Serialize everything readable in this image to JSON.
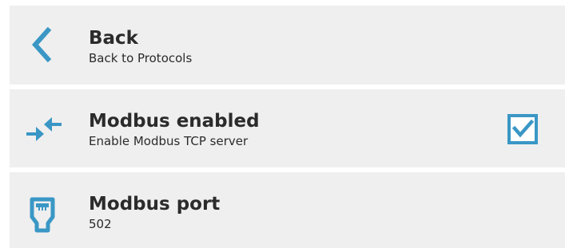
{
  "items": [
    {
      "title": "Back",
      "subtitle": "Back to Protocols",
      "icon": "chevron-left-icon"
    },
    {
      "title": "Modbus enabled",
      "subtitle": "Enable Modbus TCP server",
      "icon": "arrows-converge-icon",
      "checked": true
    },
    {
      "title": "Modbus port",
      "subtitle": "502",
      "icon": "ethernet-plug-icon"
    }
  ],
  "colors": {
    "accent": "#3a97c5",
    "row_bg": "#efefef",
    "text": "#2b2b2b"
  }
}
